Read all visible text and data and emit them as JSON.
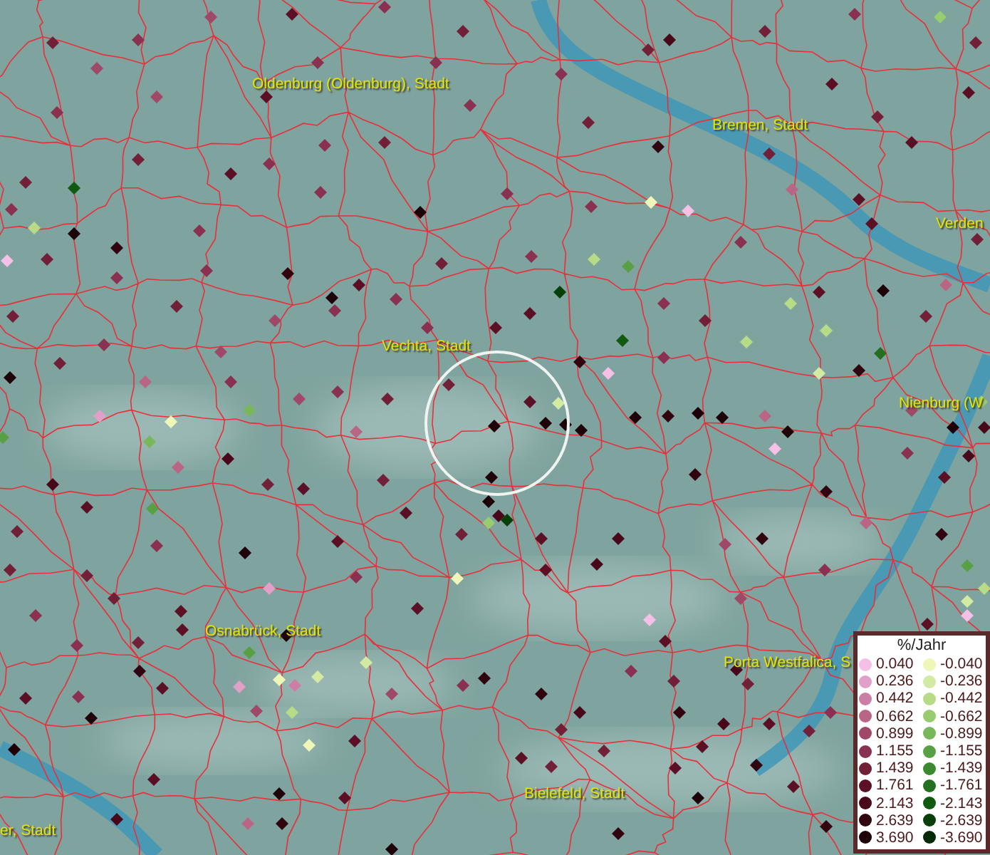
{
  "map": {
    "place_labels": [
      "Oldenburg (Oldenburg), Stadt",
      "Bremen, Stadt",
      "Verden",
      "Vechta, Stadt",
      "Nienburg (W",
      "Osnabrück, Stadt",
      "Porta Westfalica, S",
      "Bielefeld, Stadt",
      "er, Stadt"
    ],
    "legend": {
      "title": "%/Jahr",
      "rows": [
        {
          "positive": {
            "value": "0.040",
            "color": "#f4c0e6"
          },
          "negative": {
            "value": "-0.040",
            "color": "#eef6b8"
          }
        },
        {
          "positive": {
            "value": "0.236",
            "color": "#e0a0c8"
          },
          "negative": {
            "value": "-0.236",
            "color": "#d2eaa2"
          }
        },
        {
          "positive": {
            "value": "0.442",
            "color": "#cc7ea6"
          },
          "negative": {
            "value": "-0.442",
            "color": "#b6dc88"
          }
        },
        {
          "positive": {
            "value": "0.662",
            "color": "#b96686"
          },
          "negative": {
            "value": "-0.662",
            "color": "#98cc70"
          }
        },
        {
          "positive": {
            "value": "0.899",
            "color": "#a04868"
          },
          "negative": {
            "value": "-0.899",
            "color": "#78b85a"
          }
        },
        {
          "positive": {
            "value": "1.155",
            "color": "#8a3050"
          },
          "negative": {
            "value": "-1.155",
            "color": "#58a044"
          }
        },
        {
          "positive": {
            "value": "1.439",
            "color": "#722038"
          },
          "negative": {
            "value": "-1.439",
            "color": "#3c8a30"
          }
        },
        {
          "positive": {
            "value": "1.761",
            "color": "#5c1026"
          },
          "negative": {
            "value": "-1.761",
            "color": "#227020"
          }
        },
        {
          "positive": {
            "value": "2.143",
            "color": "#48081a"
          },
          "negative": {
            "value": "-2.143",
            "color": "#105a10"
          }
        },
        {
          "positive": {
            "value": "2.639",
            "color": "#300510"
          },
          "negative": {
            "value": "-2.639",
            "color": "#064008"
          }
        },
        {
          "positive": {
            "value": "3.690",
            "color": "#1e0008"
          },
          "negative": {
            "value": "-3.690",
            "color": "#022a04"
          }
        }
      ]
    }
  }
}
